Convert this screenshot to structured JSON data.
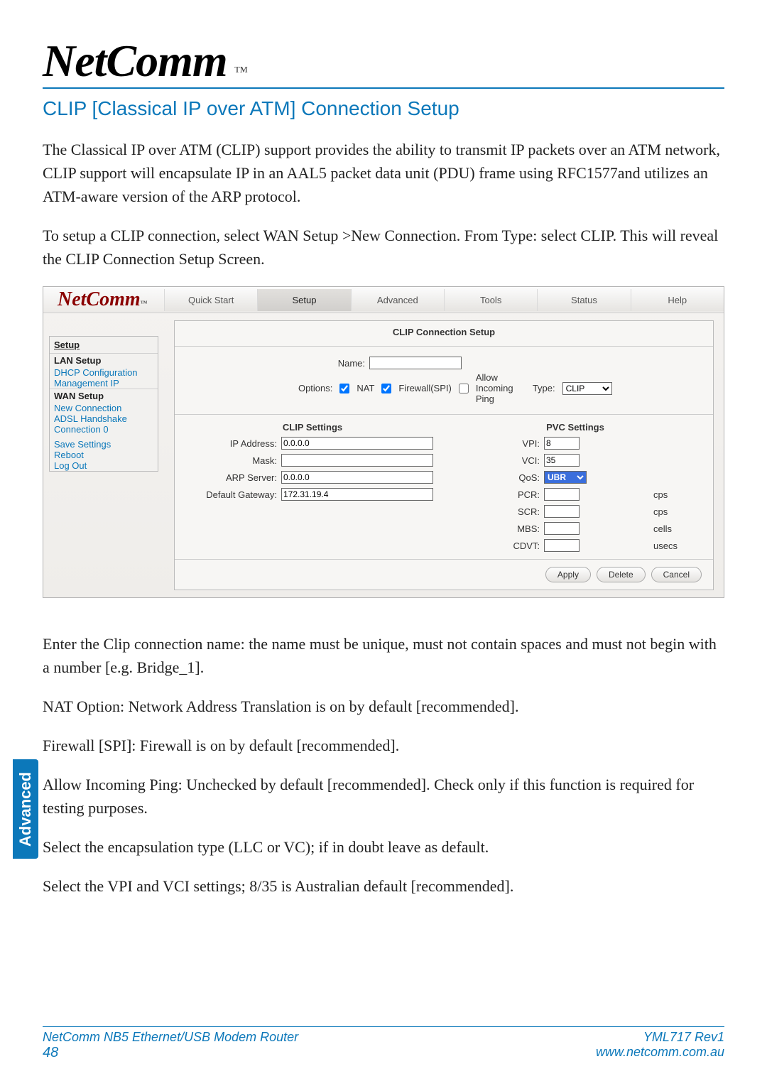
{
  "brand": {
    "name": "NetComm",
    "tm": "™"
  },
  "section_title": "CLIP [Classical IP over ATM] Connection Setup",
  "para1": "The Classical IP over ATM (CLIP) support provides the ability to transmit IP packets over an ATM network, CLIP support will encapsulate IP in an AAL5 packet data unit (PDU) frame using RFC1577and utilizes an ATM-aware version of the ARP protocol.",
  "para2": "To setup a CLIP connection, select WAN Setup >New Connection. From Type: select CLIP. This will reveal the CLIP Connection Setup Screen.",
  "shot": {
    "brand": "NetComm",
    "brand_tm": "™",
    "tabs": [
      "Quick Start",
      "Setup",
      "Advanced",
      "Tools",
      "Status",
      "Help"
    ],
    "active_tab_index": 1,
    "sidebar": {
      "title": "Setup",
      "groups": [
        {
          "head": "LAN Setup",
          "links": [
            "DHCP Configuration",
            "Management IP"
          ]
        },
        {
          "head": "WAN Setup",
          "links": [
            "New Connection",
            "ADSL Handshake",
            "Connection 0"
          ]
        }
      ],
      "actions": [
        "Save Settings",
        "Reboot",
        "Log Out"
      ]
    },
    "panel": {
      "title": "CLIP Connection Setup",
      "name_label": "Name:",
      "name_value": "",
      "options_label": "Options:",
      "nat": {
        "label": "NAT",
        "checked": true
      },
      "firewall": {
        "label": "Firewall(SPI)",
        "checked": true
      },
      "ping": {
        "label": "Allow Incoming Ping",
        "checked": false
      },
      "type_label": "Type:",
      "type_value": "CLIP",
      "clip_settings_title": "CLIP Settings",
      "clip": {
        "ip_label": "IP Address:",
        "ip": "0.0.0.0",
        "mask_label": "Mask:",
        "mask": "",
        "arp_label": "ARP Server:",
        "arp": "0.0.0.0",
        "gw_label": "Default Gateway:",
        "gw": "172.31.19.4"
      },
      "pvc_settings_title": "PVC Settings",
      "pvc": {
        "vpi_label": "VPI:",
        "vpi": "8",
        "vci_label": "VCI:",
        "vci": "35",
        "qos_label": "QoS:",
        "qos": "UBR",
        "pcr_label": "PCR:",
        "pcr": "",
        "pcr_unit": "cps",
        "scr_label": "SCR:",
        "scr": "",
        "scr_unit": "cps",
        "mbs_label": "MBS:",
        "mbs": "",
        "mbs_unit": "cells",
        "cdvt_label": "CDVT:",
        "cdvt": "",
        "cdvt_unit": "usecs"
      },
      "buttons": {
        "apply": "Apply",
        "delete": "Delete",
        "cancel": "Cancel"
      }
    }
  },
  "para3": "Enter the Clip connection name: the name must be unique, must not contain spaces and must not begin with a number [e.g. Bridge_1].",
  "para4": "NAT Option: Network Address Translation is on by default [recommended].",
  "para5": "Firewall [SPI]: Firewall is on by default [recommended].",
  "para6": "Allow Incoming Ping: Unchecked by default [recommended]. Check only if this function is required for testing purposes.",
  "para7": "Select the encapsulation type (LLC or VC); if in doubt leave as default.",
  "para8": "Select the VPI and VCI settings; 8/35 is Australian default [recommended].",
  "side_tab": "Advanced",
  "footer": {
    "left_line": "NetComm NB5 Ethernet/USB Modem Router",
    "page": "48",
    "right_line": "YML717 Rev1",
    "url": "www.netcomm.com.au"
  }
}
